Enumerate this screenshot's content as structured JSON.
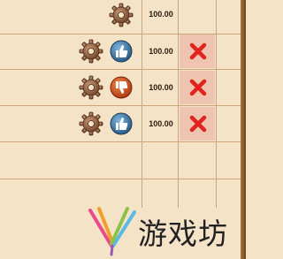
{
  "table": {
    "rows": [
      {
        "value": "100.00",
        "status": "none",
        "deletable": false
      },
      {
        "value": "100.00",
        "status": "thumbs-up",
        "deletable": true
      },
      {
        "value": "100.00",
        "status": "thumbs-down",
        "deletable": true
      },
      {
        "value": "100.00",
        "status": "thumbs-up",
        "deletable": true
      }
    ]
  },
  "colors": {
    "background": "#f5e3c8",
    "grid_line": "#c9a47c",
    "delete_cell": "#efc4b0",
    "delete_x": "#e0231c",
    "thumbs_up_badge": "#3c7aa8",
    "thumbs_down_badge": "#d9541c",
    "gear": "#8a5a3a"
  },
  "icons": {
    "gear": "gear-icon",
    "thumbs_up": "thumbs-up-icon",
    "thumbs_down": "thumbs-down-icon",
    "delete": "delete-x-icon"
  },
  "watermark": {
    "text": "游戏坊"
  }
}
